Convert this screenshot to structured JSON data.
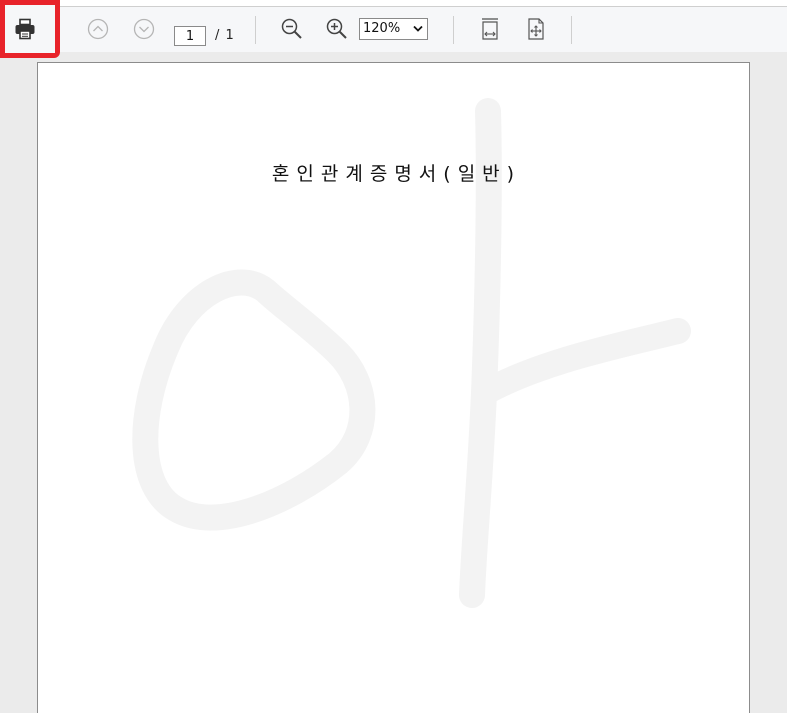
{
  "toolbar": {
    "page_number": "1",
    "page_total": "/ 1",
    "zoom_level": "120%",
    "highlight_color": "#e8232a",
    "icons": [
      "printer-icon",
      "previous-page-icon",
      "next-page-icon",
      "zoom-out-icon",
      "zoom-in-icon",
      "zoom-dropdown-arrow-icon",
      "fit-width-icon",
      "fit-page-icon"
    ]
  },
  "document": {
    "title": "혼인관계증명서(일반)"
  }
}
